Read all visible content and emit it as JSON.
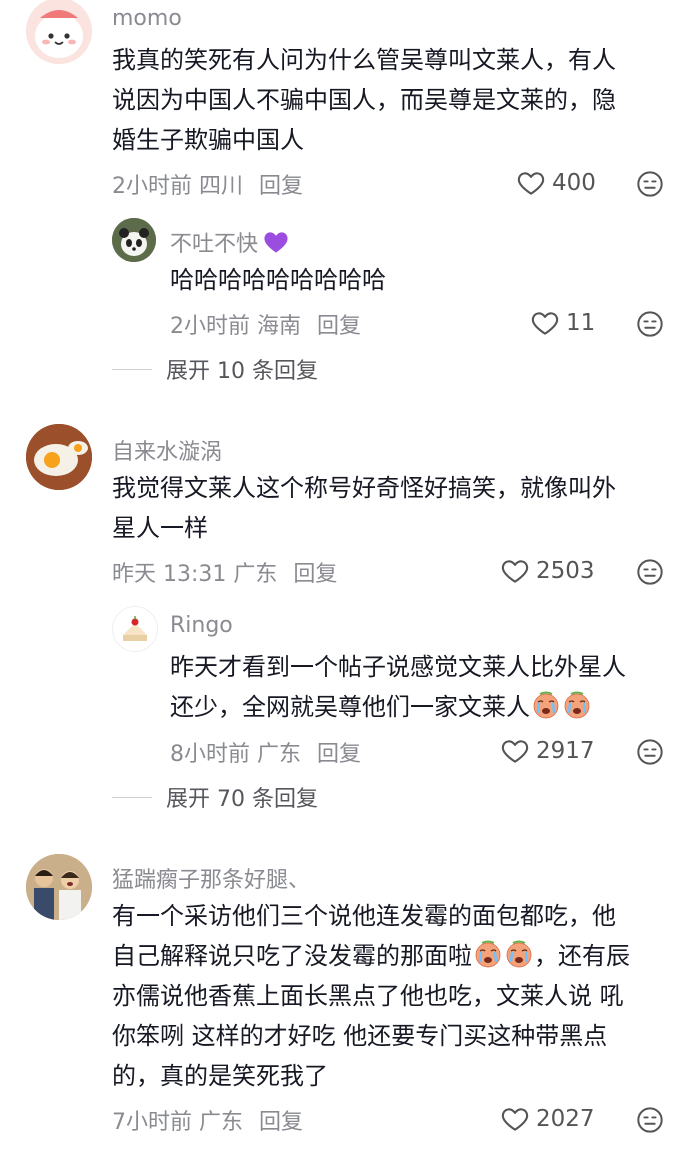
{
  "comments": [
    {
      "username": "momo",
      "lines": [
        "我真的笑死有人问为什么管吴尊叫文莱人，有人",
        "说因为中国人不骗中国人，而吴尊是文莱的，隐",
        "婚生子欺骗中国人"
      ],
      "time_location": "2小时前 四川",
      "reply_label": "回复",
      "likes": "400"
    },
    {
      "username": "不吐不快",
      "username_emoji": "purple-heart",
      "lines": [
        "哈哈哈哈哈哈哈哈哈"
      ],
      "time_location": "2小时前 海南",
      "reply_label": "回复",
      "likes": "11"
    },
    {
      "expand_label": "展开 10 条回复"
    },
    {
      "username": "自来水漩涡",
      "lines": [
        "我觉得文莱人这个称号好奇怪好搞笑，就像叫外",
        "星人一样"
      ],
      "time_location": "昨天 13:31 广东",
      "reply_label": "回复",
      "likes": "2503"
    },
    {
      "username": "Ringo",
      "lines": [
        "昨天才看到一个帖子说感觉文莱人比外星人",
        "还少，全网就吴尊他们一家文莱人"
      ],
      "time_location": "8小时前 广东",
      "reply_label": "回复",
      "likes": "2917"
    },
    {
      "expand_label": "展开 70 条回复"
    },
    {
      "username": "猛踹瘸子那条好腿、",
      "lines": [
        "有一个采访他们三个说他连发霉的面包都吃，他",
        "自己解释说只吃了没发霉的那面啦",
        "亦儒说他香蕉上面长黑点了他也吃，文莱人说 吼",
        "你笨咧 这样的才好吃  他还要专门买这种带黑点",
        "的，真的是笑死我了"
      ],
      "line2_suffix": "，还有辰",
      "time_location": "7小时前 广东",
      "reply_label": "回复",
      "likes": "2027"
    }
  ],
  "icons": {
    "like": "heart-outline-icon",
    "dislike": "unamused-face-icon",
    "crying": "crying-face-emoji",
    "heart": "purple-heart-emoji"
  },
  "colors": {
    "text": "#161823",
    "meta": "#8a8b91",
    "purple": "#9b4de0"
  }
}
